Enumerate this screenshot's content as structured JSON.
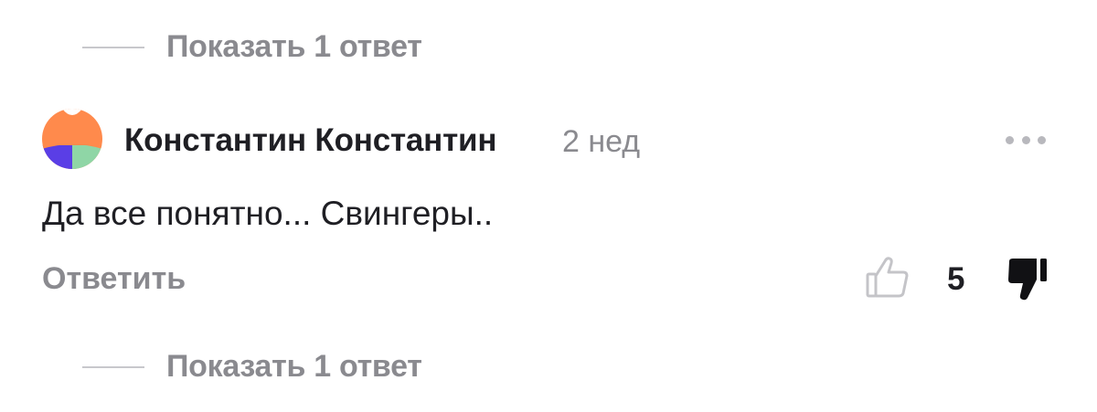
{
  "replies_top": {
    "label": "Показать 1 ответ"
  },
  "comment": {
    "author": "Константин Константин",
    "time": "2 нед",
    "text": "Да все понятно... Свингеры..",
    "reply_label": "Ответить",
    "likes": "5",
    "avatar_colors": [
      "#ff8a4c",
      "#5a3ee6",
      "#8fd6a6"
    ]
  },
  "replies_bottom": {
    "label": "Показать 1 ответ"
  },
  "icons": {
    "more": "more-dots-icon",
    "like": "thumbs-up-icon",
    "dislike": "thumbs-down-icon"
  }
}
